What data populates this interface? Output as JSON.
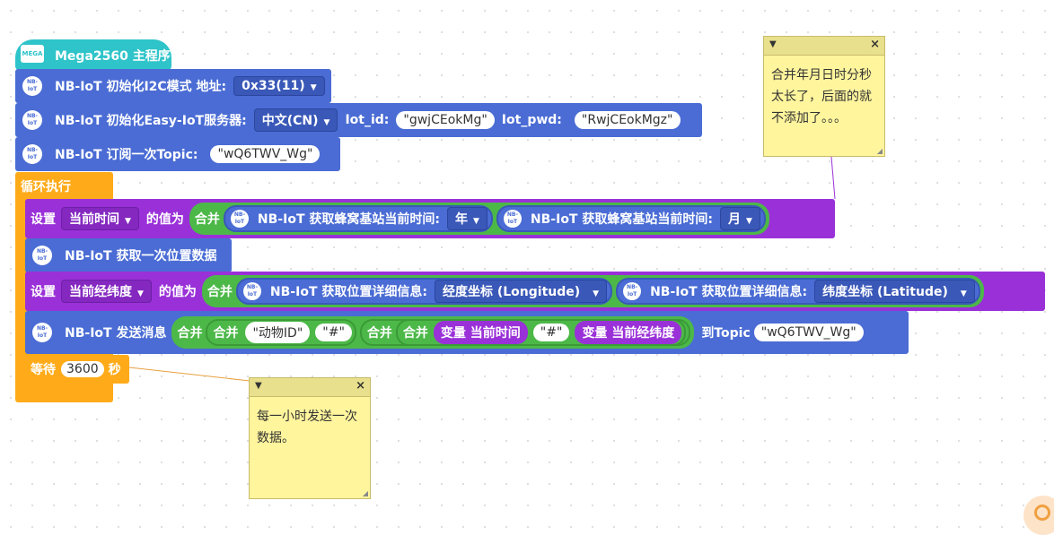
{
  "program": {
    "hat_label": "Mega2560 主程序",
    "hat_icon_text": "MEGA",
    "nb_icon_text_top": "NB-",
    "nb_icon_text_bottom": "IoT",
    "init_i2c": {
      "label": "NB-IoT 初始化I2C模式 地址:",
      "address": "0x33(11)"
    },
    "init_server": {
      "label": "NB-IoT 初始化Easy-IoT服务器:",
      "language": "中文(CN)",
      "iot_id_label": "Iot_id:",
      "iot_id": "gwjCEokMg",
      "iot_pwd_label": "Iot_pwd:",
      "iot_pwd": "RwjCEokMgz"
    },
    "subscribe": {
      "label": "NB-IoT 订阅一次Topic:",
      "topic": "wQ6TWV_Wg"
    },
    "loop_label": "循环执行",
    "set_time": {
      "set_label": "设置",
      "var": "当前时间",
      "value_label": "的值为",
      "join": "合并",
      "get_label_1": "NB-IoT 获取蜂窝基站当前时间:",
      "opt_1": "年",
      "get_label_2": "NB-IoT 获取蜂窝基站当前时间:",
      "opt_2": "月"
    },
    "get_location": {
      "label": "NB-IoT 获取一次位置数据"
    },
    "set_lnglat": {
      "set_label": "设置",
      "var": "当前经纬度",
      "value_label": "的值为",
      "join": "合并",
      "get_label_1": "NB-IoT 获取位置详细信息:",
      "opt_1": "经度坐标 (Longitude)",
      "get_label_2": "NB-IoT 获取位置详细信息:",
      "opt_2": "纬度坐标 (Latitude)"
    },
    "send": {
      "label": "NB-IoT 发送消息",
      "join": "合并",
      "str_1": "动物ID",
      "str_2": "#",
      "str_3": "#",
      "var_label": "变量",
      "var_1": "当前时间",
      "var_2": "当前经纬度",
      "to_topic": "到Topic",
      "topic": "wQ6TWV_Wg"
    },
    "wait": {
      "label": "等待",
      "value": "3600",
      "unit": "秒"
    }
  },
  "notes": [
    {
      "text": "合并年月日时分秒太长了，后面的就不添加了。。。"
    },
    {
      "text": "每一小时发送一次数据。"
    }
  ],
  "colors": {
    "hat": "#2ec4c9",
    "nbiot_block": "#4a6cd4",
    "loop": "#ffab19",
    "variable_set": "#9a31d8",
    "join": "#4cb848",
    "note": "#fff59d"
  }
}
